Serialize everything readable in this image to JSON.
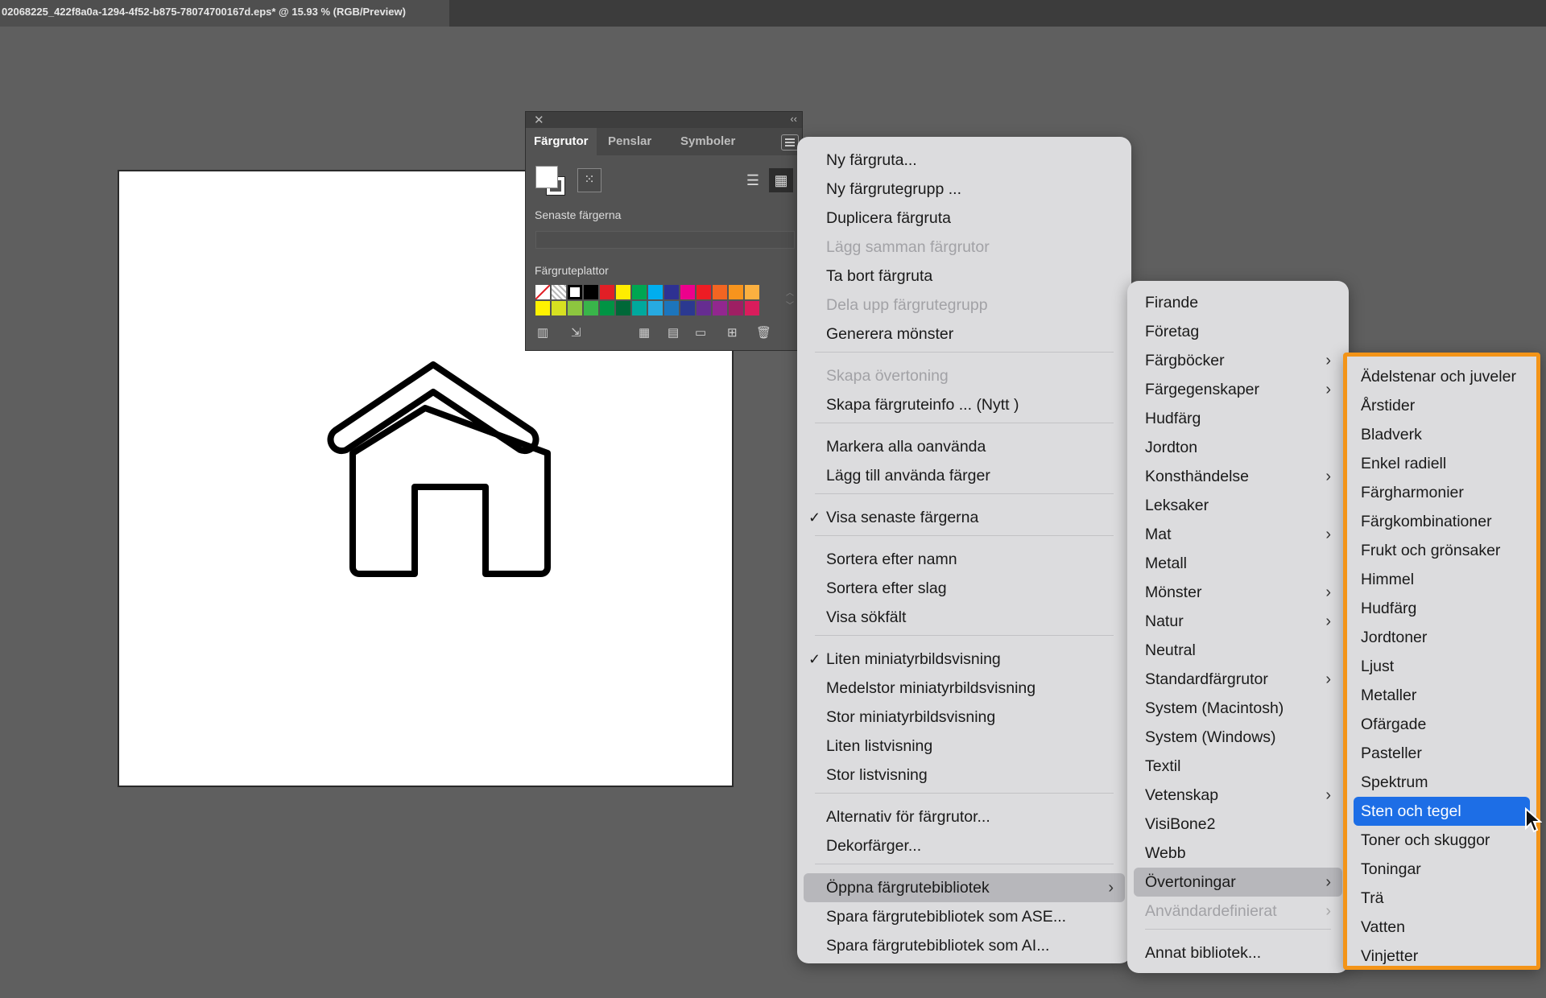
{
  "window": {
    "title": "02068225_422f8a0a-1294-4f52-b875-78074700167d.eps* @ 15.93 % (RGB/Preview)"
  },
  "panel": {
    "tabs": [
      "Färgrutor",
      "Penslar",
      "Symboler"
    ],
    "active_tab": "Färgrutor",
    "recent_label": "Senaste färgerna",
    "swatches_label": "Färgruteplattor",
    "swatch_colors_row1": [
      "#ffffff",
      "#ffffff",
      "#ffffff",
      "#000000",
      "#e11f26",
      "#ffed00",
      "#00a651",
      "#00aeef",
      "#2e3192",
      "#ec008c",
      "#ed1c24",
      "#f26522",
      "#f7941d",
      "#fbb040"
    ],
    "swatch_colors_row2": [
      "#fff200",
      "#d7e021",
      "#8dc63f",
      "#39b54a",
      "#009444",
      "#006838",
      "#00a99d",
      "#27aae1",
      "#1c75bc",
      "#2b3990",
      "#662d91",
      "#92278f",
      "#9e1f63",
      "#da1c5c"
    ]
  },
  "main_menu": {
    "items": [
      {
        "label": "Ny färgruta...",
        "disabled": false
      },
      {
        "label": "Ny färgrutegrupp ...",
        "disabled": false
      },
      {
        "label": "Duplicera färgruta",
        "disabled": false
      },
      {
        "label": "Lägg samman färgrutor",
        "disabled": true
      },
      {
        "label": "Ta bort färgruta",
        "disabled": false
      },
      {
        "label": "Dela upp färgrutegrupp",
        "disabled": true
      },
      {
        "label": "Generera mönster",
        "disabled": false
      },
      {
        "label": "Skapa övertoning",
        "disabled": true
      },
      {
        "label": "Skapa färgruteinfo ... (Nytt )",
        "disabled": false
      },
      {
        "label": "Markera alla oanvända",
        "disabled": false
      },
      {
        "label": "Lägg till använda färger",
        "disabled": false
      },
      {
        "label": "Visa senaste färgerna",
        "disabled": false,
        "checked": true
      },
      {
        "label": "Sortera efter namn",
        "disabled": false
      },
      {
        "label": "Sortera efter slag",
        "disabled": false
      },
      {
        "label": "Visa sökfält",
        "disabled": false
      },
      {
        "label": "Liten miniatyrbildsvisning",
        "disabled": false,
        "checked": true
      },
      {
        "label": "Medelstor miniatyrbildsvisning",
        "disabled": false
      },
      {
        "label": "Stor miniatyrbildsvisning",
        "disabled": false
      },
      {
        "label": "Liten listvisning",
        "disabled": false
      },
      {
        "label": "Stor listvisning",
        "disabled": false
      },
      {
        "label": "Alternativ för färgrutor...",
        "disabled": false
      },
      {
        "label": "Dekorfärger...",
        "disabled": false
      },
      {
        "label": "Öppna färgrutebibliotek",
        "disabled": false,
        "submenu": true,
        "highlighted": true
      },
      {
        "label": "Spara färgrutebibliotek som ASE...",
        "disabled": false
      },
      {
        "label": "Spara färgrutebibliotek som AI...",
        "disabled": false
      }
    ],
    "check_glyph": "✓"
  },
  "library_menu": {
    "items": [
      {
        "label": "Firande",
        "submenu": false
      },
      {
        "label": "Företag",
        "submenu": false
      },
      {
        "label": "Färgböcker",
        "submenu": true
      },
      {
        "label": "Färgegenskaper",
        "submenu": true
      },
      {
        "label": "Hudfärg",
        "submenu": false
      },
      {
        "label": "Jordton",
        "submenu": false
      },
      {
        "label": "Konsthändelse",
        "submenu": true
      },
      {
        "label": "Leksaker",
        "submenu": false
      },
      {
        "label": "Mat",
        "submenu": true
      },
      {
        "label": "Metall",
        "submenu": false
      },
      {
        "label": "Mönster",
        "submenu": true
      },
      {
        "label": "Natur",
        "submenu": true
      },
      {
        "label": "Neutral",
        "submenu": false
      },
      {
        "label": "Standardfärgrutor",
        "submenu": true
      },
      {
        "label": "System (Macintosh)",
        "submenu": false
      },
      {
        "label": "System (Windows)",
        "submenu": false
      },
      {
        "label": "Textil",
        "submenu": false
      },
      {
        "label": "Vetenskap",
        "submenu": true
      },
      {
        "label": "VisiBone2",
        "submenu": false
      },
      {
        "label": "Webb",
        "submenu": false
      },
      {
        "label": "Övertoningar",
        "submenu": true,
        "highlighted": true
      },
      {
        "label": "Användardefinierat",
        "submenu": true,
        "disabled": true
      },
      {
        "label": "Annat bibliotek...",
        "submenu": false
      }
    ]
  },
  "gradient_menu": {
    "items": [
      "Ädelstenar och juveler",
      "Årstider",
      "Bladverk",
      "Enkel radiell",
      "Färgharmonier",
      "Färgkombinationer",
      "Frukt och grönsaker",
      "Himmel",
      "Hudfärg",
      "Jordtoner",
      "Ljust",
      "Metaller",
      "Ofärgade",
      "Pasteller",
      "Spektrum",
      "Sten och tegel",
      "Toner och skuggor",
      "Toningar",
      "Trä",
      "Vatten",
      "Vinjetter"
    ],
    "selected": "Sten och tegel"
  },
  "colors": {
    "highlight_blue": "#1d6ee6",
    "highlight_gray": "#b7b7bb",
    "callout_orange": "#f39418"
  },
  "glyphs": {
    "chevron": "›",
    "close": "✕",
    "collapse": "‹‹"
  }
}
